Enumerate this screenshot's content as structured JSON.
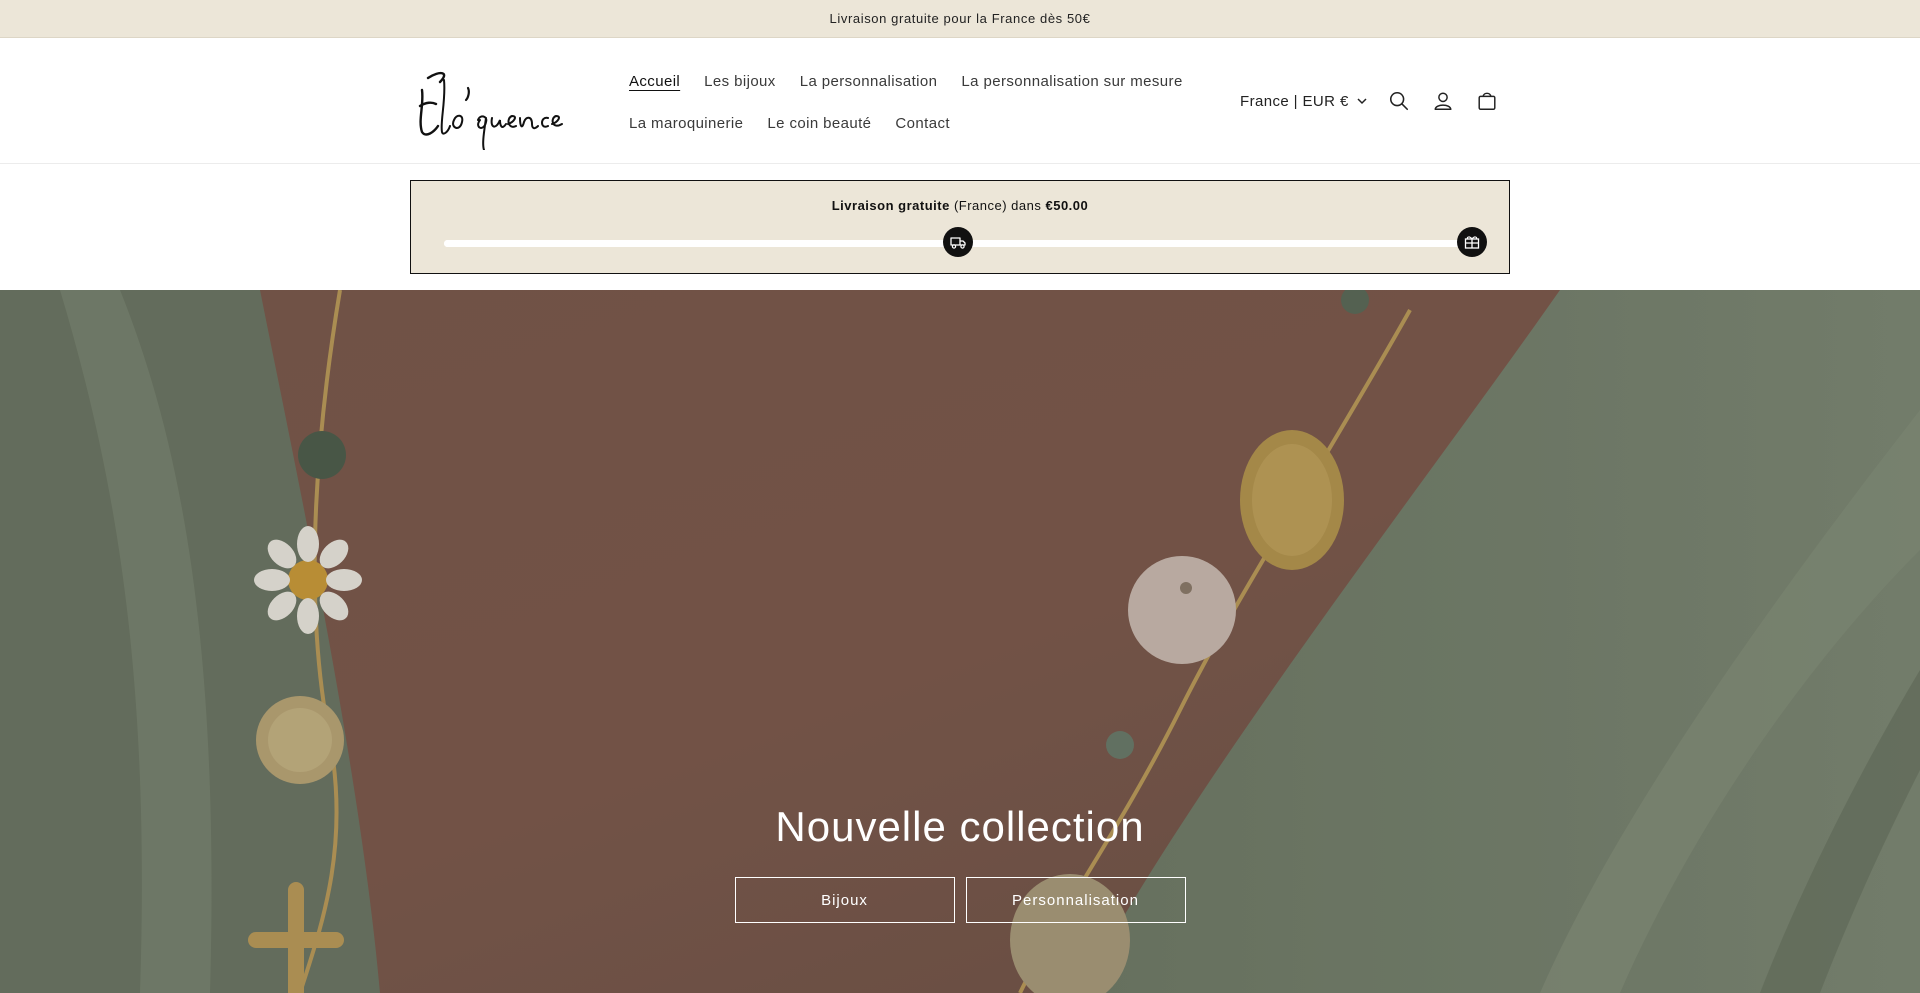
{
  "announcement": {
    "text": "Livraison gratuite pour la France dès 50€"
  },
  "header": {
    "logo_text": "Elo'quence",
    "nav": {
      "row1": [
        {
          "label": "Accueil",
          "active": true
        },
        {
          "label": "Les bijoux"
        },
        {
          "label": "La personnalisation"
        },
        {
          "label": "La personnalisation sur mesure"
        }
      ],
      "row2": [
        {
          "label": "La maroquinerie"
        },
        {
          "label": "Le coin beauté"
        },
        {
          "label": "Contact"
        }
      ]
    },
    "country_selector": "France | EUR €",
    "icons": [
      "search-icon",
      "account-icon",
      "cart-icon"
    ]
  },
  "shipping_bar": {
    "bold_label": "Livraison gratuite",
    "middle_text": "(France) dans",
    "amount": "€50.00",
    "progress": 0.5
  },
  "hero": {
    "title": "Nouvelle collection",
    "buttons": [
      {
        "label": "Bijoux"
      },
      {
        "label": "Personnalisation"
      }
    ]
  },
  "colors": {
    "announcement_bg": "#ece6d8",
    "shipbar_bg": "#ece6d8",
    "accent": "#111111"
  }
}
